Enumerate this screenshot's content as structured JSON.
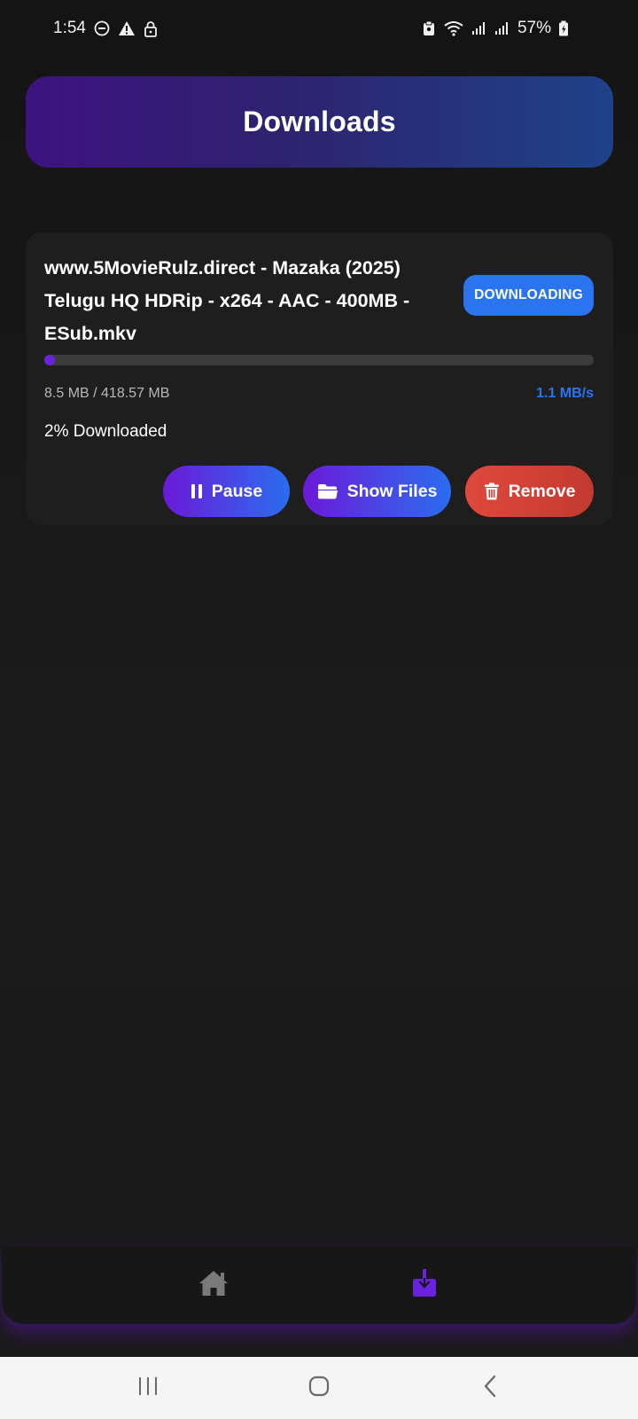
{
  "status_bar": {
    "time": "1:54",
    "battery": "57%",
    "left_icons": [
      "do-not-disturb-icon",
      "warning-icon",
      "lock-icon"
    ],
    "right_icons": [
      "clipboard-icon",
      "wifi-icon",
      "signal-icon",
      "signal-icon",
      "battery-charging-icon"
    ]
  },
  "header": {
    "title": "Downloads"
  },
  "download": {
    "file_name": "www.5MovieRulz.direct - Mazaka (2025) Telugu HQ HDRip - x264 - AAC - 400MB - ESub.mkv",
    "status": "DOWNLOADING",
    "progress": 0.02,
    "size_text": "8.5 MB / 418.57 MB",
    "speed_text": "1.1 MB/s",
    "percent_text": "2% Downloaded",
    "buttons": {
      "pause": "Pause",
      "show_files": "Show Files",
      "remove": "Remove"
    }
  },
  "bottom_nav": {
    "items": [
      {
        "icon": "home-icon",
        "active": false
      },
      {
        "icon": "download-icon",
        "active": true
      }
    ]
  },
  "colors": {
    "accent_blue": "#2a74f0",
    "accent_purple": "#6b22e0",
    "danger_red": "#d9443a"
  }
}
